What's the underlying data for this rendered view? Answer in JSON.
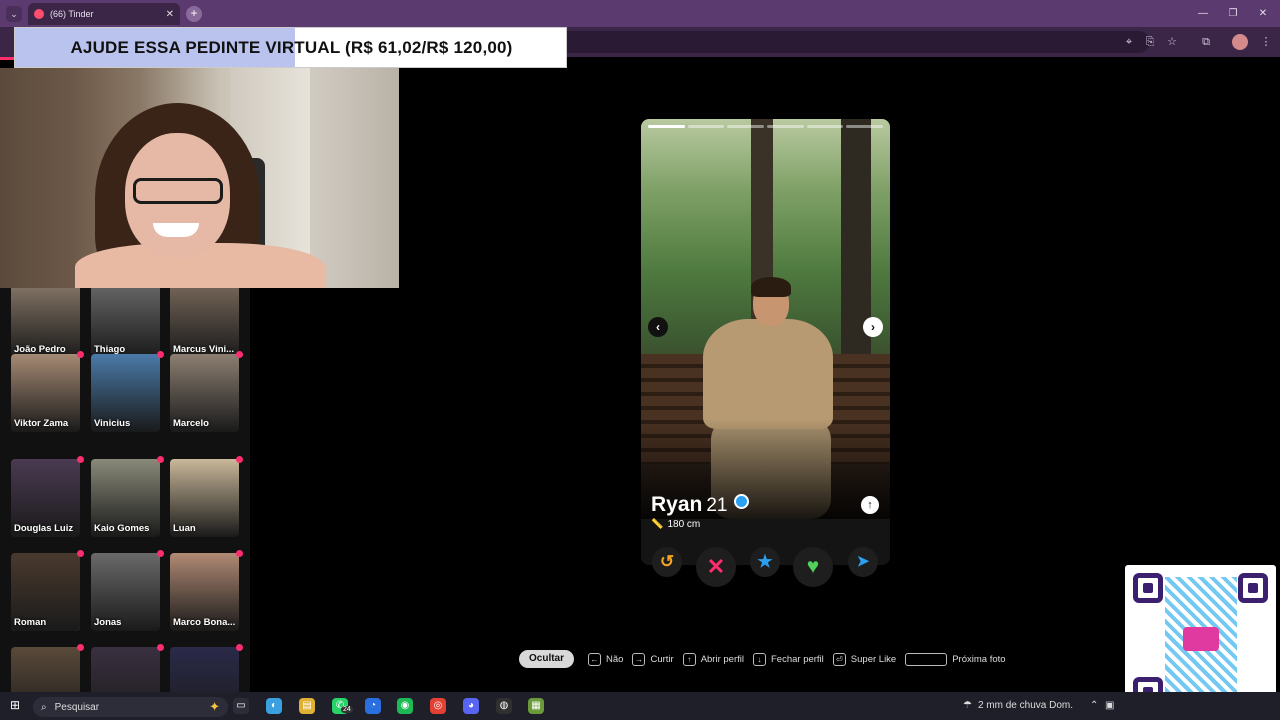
{
  "browser": {
    "tab_title": "(66) Tinder",
    "tab_close": "✕",
    "new_tab": "+",
    "tab_dropdown": "⌄",
    "window_controls": [
      "—",
      "❐",
      "✕"
    ]
  },
  "banner": {
    "text": "AJUDE ESSA PEDINTE VIRTUAL (R$ 61,02/R$ 120,00)",
    "raised": 61.02,
    "goal": 120.0,
    "progress_color": "#b9c3ee"
  },
  "matches": [
    {
      "name": "João Pedro",
      "new": false
    },
    {
      "name": "Thiago",
      "new": false
    },
    {
      "name": "Marcus Vini...",
      "new": false
    },
    {
      "name": "Viktor Zama",
      "new": true
    },
    {
      "name": "Vinicius",
      "new": true
    },
    {
      "name": "Marcelo",
      "new": true
    },
    {
      "name": "Douglas Luiz",
      "new": true
    },
    {
      "name": "Kaio Gomes",
      "new": true
    },
    {
      "name": "Luan",
      "new": true
    },
    {
      "name": "Roman",
      "new": true,
      "super_like": true
    },
    {
      "name": "Jonas",
      "new": true
    },
    {
      "name": "Marco Bona...",
      "new": true
    },
    {
      "name": "",
      "new": true
    },
    {
      "name": "",
      "new": true
    },
    {
      "name": "",
      "new": true
    }
  ],
  "profile": {
    "name": "Ryan",
    "age": "21",
    "height": "180 cm",
    "verified": true,
    "photo_count": 6,
    "active_photo": 1,
    "prev_arrow": "‹",
    "next_arrow": "›",
    "expand_icon": "↑"
  },
  "actions": {
    "rewind": "↺",
    "nope": "✕",
    "super_like": "★",
    "like": "♥",
    "boost": "➤"
  },
  "shortcuts": {
    "hide": "Ocultar",
    "items": [
      {
        "key": "←",
        "label": "Não"
      },
      {
        "key": "→",
        "label": "Curtir"
      },
      {
        "key": "↑",
        "label": "Abrir perfil"
      },
      {
        "key": "↓",
        "label": "Fechar perfil"
      },
      {
        "key": "⏎",
        "label": "Super Like"
      },
      {
        "key": "",
        "label": "Próxima foto"
      }
    ]
  },
  "taskbar": {
    "start_icon": "⊞",
    "search_placeholder": "Pesquisar",
    "weather": "2 mm de chuva Dom.",
    "apps": [
      "task-view",
      "copilot",
      "file-explorer",
      "whatsapp",
      "edge",
      "spotify",
      "chrome",
      "discord",
      "obs",
      "minecraft"
    ],
    "whatsapp_badge": "24"
  },
  "colors": {
    "tinder_pink": "#fd2e6e",
    "chrome_purple": "#5b3a70",
    "verify_blue": "#2aa0f0"
  }
}
